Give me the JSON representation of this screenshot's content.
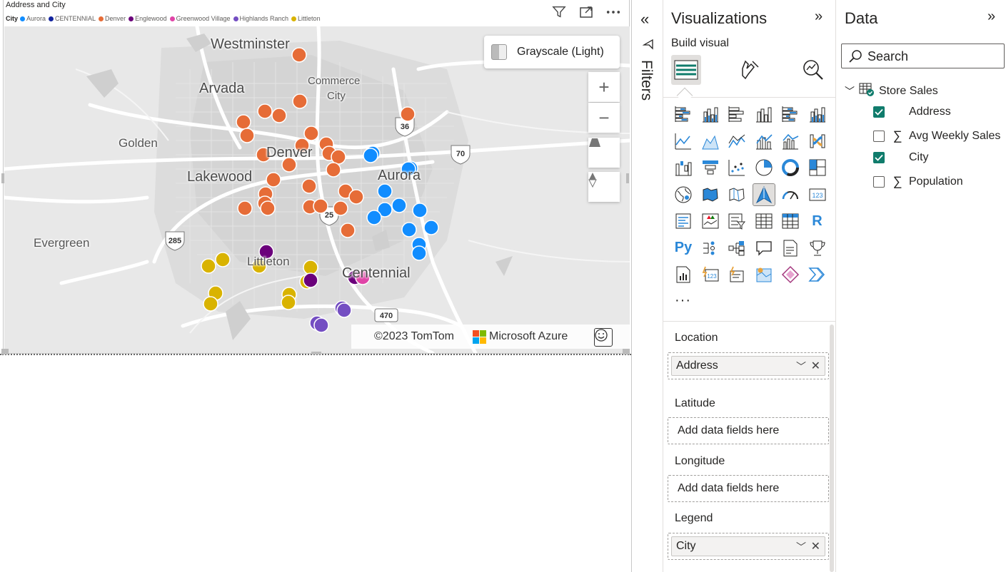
{
  "visual": {
    "title": "Address and City",
    "legend_title": "City",
    "legend_items": [
      {
        "label": "Aurora",
        "color": "#118DFF"
      },
      {
        "label": "CENTENNIAL",
        "color": "#12239E"
      },
      {
        "label": "Denver",
        "color": "#E66C37"
      },
      {
        "label": "Englewood",
        "color": "#6B007B"
      },
      {
        "label": "Greenwood Village",
        "color": "#E044A7"
      },
      {
        "label": "Highlands Ranch",
        "color": "#744EC2"
      },
      {
        "label": "Littleton",
        "color": "#D9B300"
      }
    ]
  },
  "map": {
    "style_label": "Grayscale (Light)",
    "zoom_in": "+",
    "zoom_out": "−",
    "attribution": "©2023 TomTom",
    "provider": "Microsoft Azure",
    "places": [
      "Westminster",
      "Arvada",
      "Commerce",
      "City",
      "Golden",
      "Denver",
      "Lakewood",
      "Aurora",
      "Evergreen",
      "Littleton",
      "Centennial"
    ],
    "highways": [
      "36",
      "70",
      "25",
      "285",
      "470"
    ]
  },
  "filters": {
    "label": "Filters"
  },
  "visualizations": {
    "title": "Visualizations",
    "build_label": "Build visual",
    "more": "···",
    "r_label": "R",
    "py_label": "Py"
  },
  "wells": {
    "location_label": "Location",
    "location_field": "Address",
    "latitude_label": "Latitude",
    "latitude_placeholder": "Add data fields here",
    "longitude_label": "Longitude",
    "longitude_placeholder": "Add data fields here",
    "legend_label": "Legend",
    "legend_field": "City"
  },
  "data_pane": {
    "title": "Data",
    "search_placeholder": "Search",
    "table": "Store Sales",
    "fields": [
      {
        "name": "Address",
        "checked": true,
        "sigma": false
      },
      {
        "name": "Avg Weekly Sales",
        "checked": false,
        "sigma": true
      },
      {
        "name": "City",
        "checked": true,
        "sigma": false
      },
      {
        "name": "Population",
        "checked": false,
        "sigma": true
      }
    ],
    "sigma_symbol": "∑"
  }
}
